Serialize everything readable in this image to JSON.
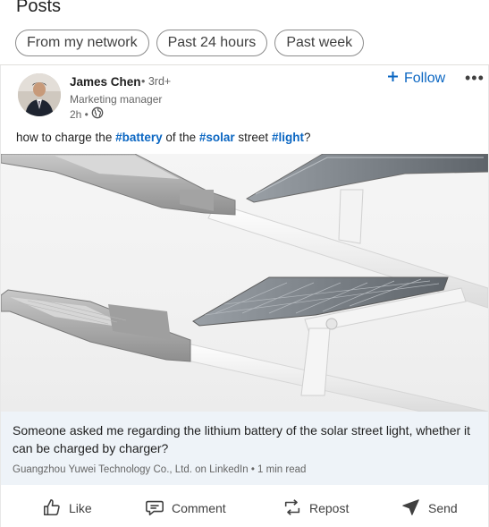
{
  "header": {
    "title": "Posts"
  },
  "filters": [
    {
      "label": "From my network"
    },
    {
      "label": "Past 24 hours"
    },
    {
      "label": "Past week"
    }
  ],
  "post": {
    "author": {
      "name": "James Chen",
      "degree": "• 3rd+",
      "headline": "Marketing manager",
      "time": "2h •"
    },
    "follow_label": "Follow",
    "more_label": "•••",
    "text": {
      "p1": "how to charge the ",
      "tag1": "#battery",
      "p2": " of the ",
      "tag2": "#solar",
      "p3": " street ",
      "tag3": "#light",
      "p4": "?"
    },
    "link": {
      "title": "Someone asked me regarding the lithium battery of the solar street light, whether it can be charged by charger?",
      "source": "Guangzhou Yuwei Technology Co., Ltd. on LinkedIn • 1 min read"
    },
    "actions": {
      "like": "Like",
      "comment": "Comment",
      "repost": "Repost",
      "send": "Send"
    }
  },
  "colors": {
    "accent": "#0a66c2",
    "link_bg": "#eef3f8",
    "text": "#1f1f1f",
    "muted": "#666666"
  },
  "icons": [
    "globe-icon",
    "plus-icon",
    "like-icon",
    "comment-icon",
    "repost-icon",
    "send-icon"
  ]
}
